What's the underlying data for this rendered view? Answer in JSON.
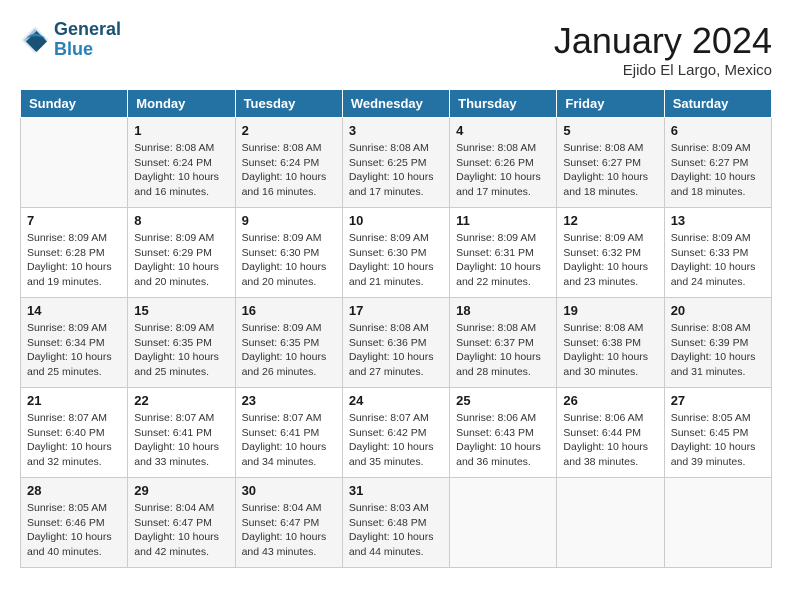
{
  "logo": {
    "line1": "General",
    "line2": "Blue"
  },
  "header": {
    "month": "January 2024",
    "location": "Ejido El Largo, Mexico"
  },
  "columns": [
    "Sunday",
    "Monday",
    "Tuesday",
    "Wednesday",
    "Thursday",
    "Friday",
    "Saturday"
  ],
  "weeks": [
    [
      {
        "day": "",
        "sunrise": "",
        "sunset": "",
        "daylight": ""
      },
      {
        "day": "1",
        "sunrise": "Sunrise: 8:08 AM",
        "sunset": "Sunset: 6:24 PM",
        "daylight": "Daylight: 10 hours and 16 minutes."
      },
      {
        "day": "2",
        "sunrise": "Sunrise: 8:08 AM",
        "sunset": "Sunset: 6:24 PM",
        "daylight": "Daylight: 10 hours and 16 minutes."
      },
      {
        "day": "3",
        "sunrise": "Sunrise: 8:08 AM",
        "sunset": "Sunset: 6:25 PM",
        "daylight": "Daylight: 10 hours and 17 minutes."
      },
      {
        "day": "4",
        "sunrise": "Sunrise: 8:08 AM",
        "sunset": "Sunset: 6:26 PM",
        "daylight": "Daylight: 10 hours and 17 minutes."
      },
      {
        "day": "5",
        "sunrise": "Sunrise: 8:08 AM",
        "sunset": "Sunset: 6:27 PM",
        "daylight": "Daylight: 10 hours and 18 minutes."
      },
      {
        "day": "6",
        "sunrise": "Sunrise: 8:09 AM",
        "sunset": "Sunset: 6:27 PM",
        "daylight": "Daylight: 10 hours and 18 minutes."
      }
    ],
    [
      {
        "day": "7",
        "sunrise": "Sunrise: 8:09 AM",
        "sunset": "Sunset: 6:28 PM",
        "daylight": "Daylight: 10 hours and 19 minutes."
      },
      {
        "day": "8",
        "sunrise": "Sunrise: 8:09 AM",
        "sunset": "Sunset: 6:29 PM",
        "daylight": "Daylight: 10 hours and 20 minutes."
      },
      {
        "day": "9",
        "sunrise": "Sunrise: 8:09 AM",
        "sunset": "Sunset: 6:30 PM",
        "daylight": "Daylight: 10 hours and 20 minutes."
      },
      {
        "day": "10",
        "sunrise": "Sunrise: 8:09 AM",
        "sunset": "Sunset: 6:30 PM",
        "daylight": "Daylight: 10 hours and 21 minutes."
      },
      {
        "day": "11",
        "sunrise": "Sunrise: 8:09 AM",
        "sunset": "Sunset: 6:31 PM",
        "daylight": "Daylight: 10 hours and 22 minutes."
      },
      {
        "day": "12",
        "sunrise": "Sunrise: 8:09 AM",
        "sunset": "Sunset: 6:32 PM",
        "daylight": "Daylight: 10 hours and 23 minutes."
      },
      {
        "day": "13",
        "sunrise": "Sunrise: 8:09 AM",
        "sunset": "Sunset: 6:33 PM",
        "daylight": "Daylight: 10 hours and 24 minutes."
      }
    ],
    [
      {
        "day": "14",
        "sunrise": "Sunrise: 8:09 AM",
        "sunset": "Sunset: 6:34 PM",
        "daylight": "Daylight: 10 hours and 25 minutes."
      },
      {
        "day": "15",
        "sunrise": "Sunrise: 8:09 AM",
        "sunset": "Sunset: 6:35 PM",
        "daylight": "Daylight: 10 hours and 25 minutes."
      },
      {
        "day": "16",
        "sunrise": "Sunrise: 8:09 AM",
        "sunset": "Sunset: 6:35 PM",
        "daylight": "Daylight: 10 hours and 26 minutes."
      },
      {
        "day": "17",
        "sunrise": "Sunrise: 8:08 AM",
        "sunset": "Sunset: 6:36 PM",
        "daylight": "Daylight: 10 hours and 27 minutes."
      },
      {
        "day": "18",
        "sunrise": "Sunrise: 8:08 AM",
        "sunset": "Sunset: 6:37 PM",
        "daylight": "Daylight: 10 hours and 28 minutes."
      },
      {
        "day": "19",
        "sunrise": "Sunrise: 8:08 AM",
        "sunset": "Sunset: 6:38 PM",
        "daylight": "Daylight: 10 hours and 30 minutes."
      },
      {
        "day": "20",
        "sunrise": "Sunrise: 8:08 AM",
        "sunset": "Sunset: 6:39 PM",
        "daylight": "Daylight: 10 hours and 31 minutes."
      }
    ],
    [
      {
        "day": "21",
        "sunrise": "Sunrise: 8:07 AM",
        "sunset": "Sunset: 6:40 PM",
        "daylight": "Daylight: 10 hours and 32 minutes."
      },
      {
        "day": "22",
        "sunrise": "Sunrise: 8:07 AM",
        "sunset": "Sunset: 6:41 PM",
        "daylight": "Daylight: 10 hours and 33 minutes."
      },
      {
        "day": "23",
        "sunrise": "Sunrise: 8:07 AM",
        "sunset": "Sunset: 6:41 PM",
        "daylight": "Daylight: 10 hours and 34 minutes."
      },
      {
        "day": "24",
        "sunrise": "Sunrise: 8:07 AM",
        "sunset": "Sunset: 6:42 PM",
        "daylight": "Daylight: 10 hours and 35 minutes."
      },
      {
        "day": "25",
        "sunrise": "Sunrise: 8:06 AM",
        "sunset": "Sunset: 6:43 PM",
        "daylight": "Daylight: 10 hours and 36 minutes."
      },
      {
        "day": "26",
        "sunrise": "Sunrise: 8:06 AM",
        "sunset": "Sunset: 6:44 PM",
        "daylight": "Daylight: 10 hours and 38 minutes."
      },
      {
        "day": "27",
        "sunrise": "Sunrise: 8:05 AM",
        "sunset": "Sunset: 6:45 PM",
        "daylight": "Daylight: 10 hours and 39 minutes."
      }
    ],
    [
      {
        "day": "28",
        "sunrise": "Sunrise: 8:05 AM",
        "sunset": "Sunset: 6:46 PM",
        "daylight": "Daylight: 10 hours and 40 minutes."
      },
      {
        "day": "29",
        "sunrise": "Sunrise: 8:04 AM",
        "sunset": "Sunset: 6:47 PM",
        "daylight": "Daylight: 10 hours and 42 minutes."
      },
      {
        "day": "30",
        "sunrise": "Sunrise: 8:04 AM",
        "sunset": "Sunset: 6:47 PM",
        "daylight": "Daylight: 10 hours and 43 minutes."
      },
      {
        "day": "31",
        "sunrise": "Sunrise: 8:03 AM",
        "sunset": "Sunset: 6:48 PM",
        "daylight": "Daylight: 10 hours and 44 minutes."
      },
      {
        "day": "",
        "sunrise": "",
        "sunset": "",
        "daylight": ""
      },
      {
        "day": "",
        "sunrise": "",
        "sunset": "",
        "daylight": ""
      },
      {
        "day": "",
        "sunrise": "",
        "sunset": "",
        "daylight": ""
      }
    ]
  ]
}
